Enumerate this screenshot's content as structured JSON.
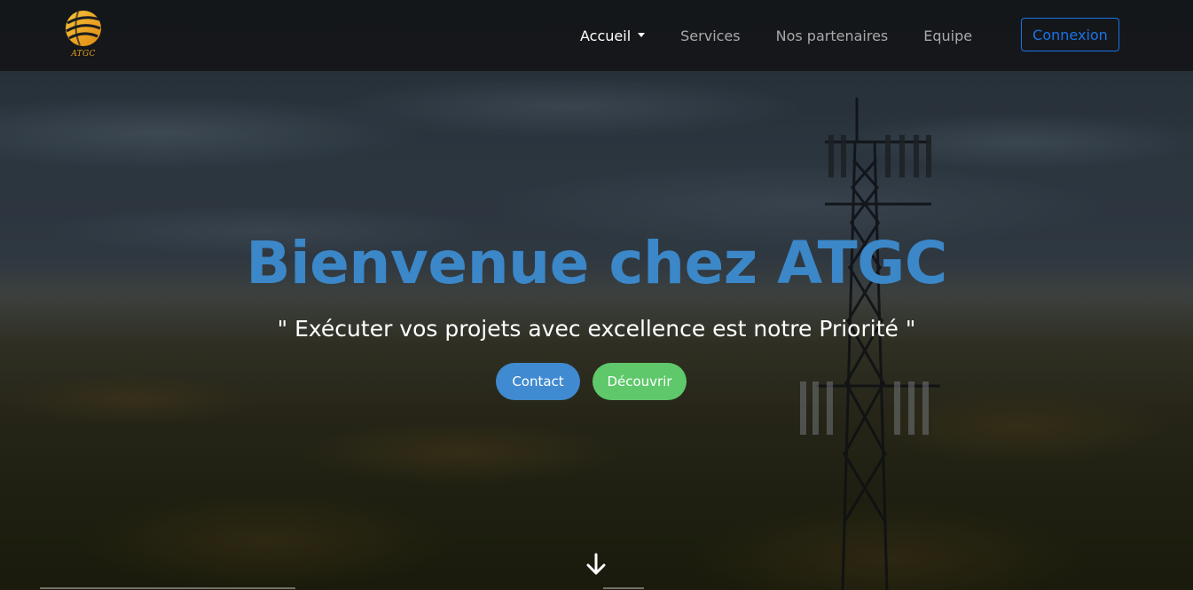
{
  "brand": {
    "logo_text": "ATGC",
    "icon": "atgc-globe-logo-icon"
  },
  "nav": {
    "items": [
      {
        "label": "Accueil",
        "active": true,
        "dropdown": true
      },
      {
        "label": "Services",
        "active": false
      },
      {
        "label": "Nos partenaires",
        "active": false
      },
      {
        "label": "Equipe",
        "active": false
      }
    ],
    "login_label": "Connexion"
  },
  "hero": {
    "title": "Bienvenue chez ATGC",
    "subtitle": "\" Exécuter vos projets avec excellence est notre Priorité \"",
    "buttons": {
      "contact": "Contact",
      "discover": "Découvrir"
    },
    "scroll_icon": "arrow-down-icon"
  },
  "colors": {
    "title": "#3b87c8",
    "contact_button": "#3f8ad0",
    "discover_button": "#5ec86a",
    "login_border": "#1a73e8",
    "logo_accent": "#e7a31f"
  }
}
